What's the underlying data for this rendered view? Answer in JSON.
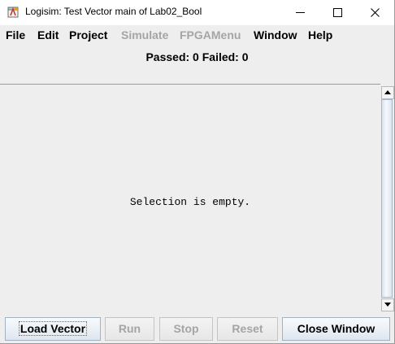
{
  "window": {
    "title": "Logisim: Test Vector main of Lab02_Bool",
    "controls": {
      "minimize_icon": "minimize-icon",
      "maximize_icon": "maximize-icon",
      "close_icon": "close-icon"
    }
  },
  "menubar": {
    "items": [
      {
        "label": "File",
        "enabled": true
      },
      {
        "label": "Edit",
        "enabled": true
      },
      {
        "label": "Project",
        "enabled": true
      },
      {
        "label": "Simulate",
        "enabled": false
      },
      {
        "label": "FPGAMenu",
        "enabled": false
      },
      {
        "label": "Window",
        "enabled": true
      },
      {
        "label": "Help",
        "enabled": true
      }
    ]
  },
  "status": {
    "text": "Passed: 0 Failed: 0"
  },
  "content": {
    "message": "Selection is empty."
  },
  "buttons": {
    "load_vector": {
      "label": "Load Vector",
      "enabled": true,
      "focused": true
    },
    "run": {
      "label": "Run",
      "enabled": false
    },
    "stop": {
      "label": "Stop",
      "enabled": false
    },
    "reset": {
      "label": "Reset",
      "enabled": false
    },
    "close_window": {
      "label": "Close Window",
      "enabled": true
    }
  },
  "colors": {
    "background": "#eeeeee",
    "disabled_text": "#a5a5a5",
    "button_border": "#a3b2c3"
  }
}
